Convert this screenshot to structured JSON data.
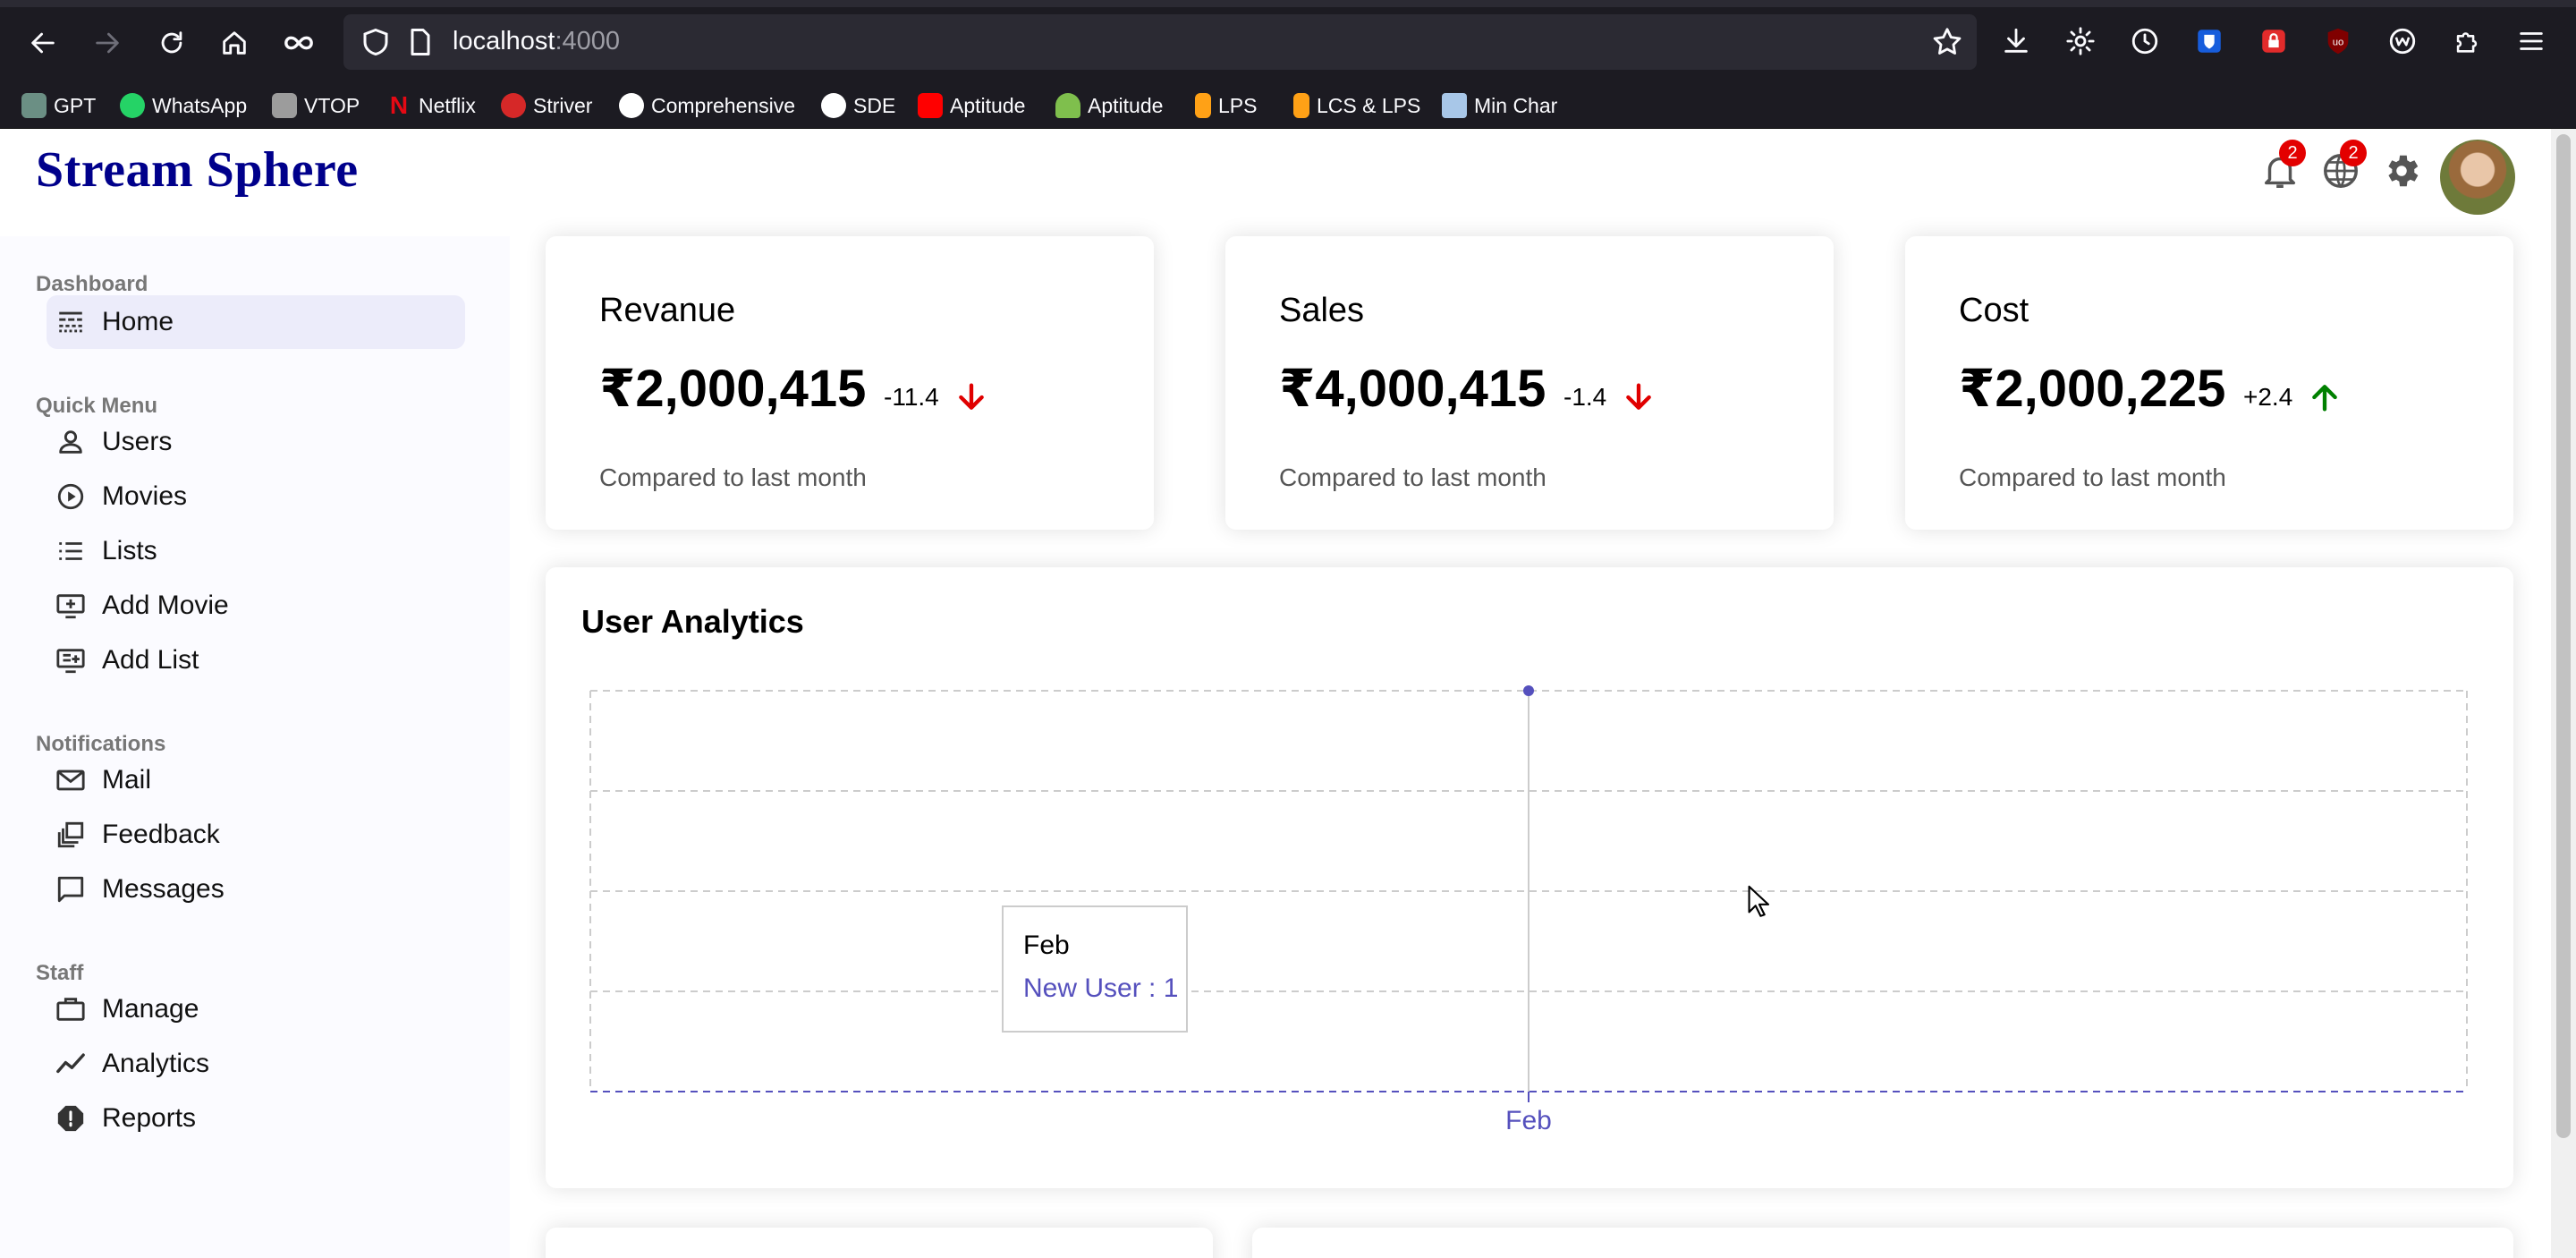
{
  "browser": {
    "url_host": "localhost",
    "url_port": ":4000",
    "bookmarks": [
      {
        "label": "GPT",
        "icon": "chatgpt-icon",
        "color": "#6b8f84"
      },
      {
        "label": "WhatsApp",
        "icon": "whatsapp-icon",
        "color": "#25d366"
      },
      {
        "label": "VTOP",
        "icon": "vtop-icon",
        "color": "#9c9c9c"
      },
      {
        "label": "Netflix",
        "icon": "netflix-icon",
        "color": "#e50914"
      },
      {
        "label": "Striver",
        "icon": "tuf-icon",
        "color": "#d62828"
      },
      {
        "label": "Comprehensive",
        "icon": "github-icon",
        "color": "#ffffff"
      },
      {
        "label": "SDE",
        "icon": "github-icon",
        "color": "#ffffff"
      },
      {
        "label": "Aptitude",
        "icon": "youtube-icon",
        "color": "#ff0000"
      },
      {
        "label": "Aptitude",
        "icon": "indiabix-icon",
        "color": "#7fbf4d"
      },
      {
        "label": "LPS",
        "icon": "leetcode-icon",
        "color": "#ffa116"
      },
      {
        "label": "LCS & LPS",
        "icon": "leetcode-icon",
        "color": "#ffa116"
      },
      {
        "label": "Min Char",
        "icon": "mountain-icon",
        "color": "#a8c7e8"
      }
    ]
  },
  "app": {
    "logo": "Stream Sphere",
    "notifications_badge": "2",
    "language_badge": "2"
  },
  "sidebar": {
    "sections": [
      {
        "title": "Dashboard",
        "items": [
          {
            "label": "Home",
            "icon": "timeline-icon",
            "active": true
          }
        ]
      },
      {
        "title": "Quick Menu",
        "items": [
          {
            "label": "Users",
            "icon": "user-icon"
          },
          {
            "label": "Movies",
            "icon": "play-circle-icon"
          },
          {
            "label": "Lists",
            "icon": "list-icon"
          },
          {
            "label": "Add Movie",
            "icon": "add-to-queue-icon"
          },
          {
            "label": "Add List",
            "icon": "playlist-add-icon"
          }
        ]
      },
      {
        "title": "Notifications",
        "items": [
          {
            "label": "Mail",
            "icon": "mail-icon"
          },
          {
            "label": "Feedback",
            "icon": "dynamic-feed-icon"
          },
          {
            "label": "Messages",
            "icon": "chat-bubble-icon"
          }
        ]
      },
      {
        "title": "Staff",
        "items": [
          {
            "label": "Manage",
            "icon": "work-outline-icon"
          },
          {
            "label": "Analytics",
            "icon": "timeline-chart-icon"
          },
          {
            "label": "Reports",
            "icon": "report-icon"
          }
        ]
      }
    ]
  },
  "featured": [
    {
      "title": "Revanue",
      "amount": "₹2,000,415",
      "rate": "-11.4",
      "trend": "down",
      "subtitle": "Compared to last month"
    },
    {
      "title": "Sales",
      "amount": "₹4,000,415",
      "rate": "-1.4",
      "trend": "down",
      "subtitle": "Compared to last month"
    },
    {
      "title": "Cost",
      "amount": "₹2,000,225",
      "rate": "+2.4",
      "trend": "up",
      "subtitle": "Compared to last month"
    }
  ],
  "colors": {
    "logo": "#00008b",
    "down": "#e00000",
    "up": "#008000",
    "chart_line": "#5550bd",
    "badge": "#e30000"
  },
  "chart_data": {
    "type": "line",
    "title": "User Analytics",
    "categories": [
      "Feb"
    ],
    "series": [
      {
        "name": "New User",
        "values": [
          1
        ]
      }
    ],
    "grid": true,
    "tooltip": {
      "label": "Feb",
      "value": "New User : 1"
    }
  }
}
